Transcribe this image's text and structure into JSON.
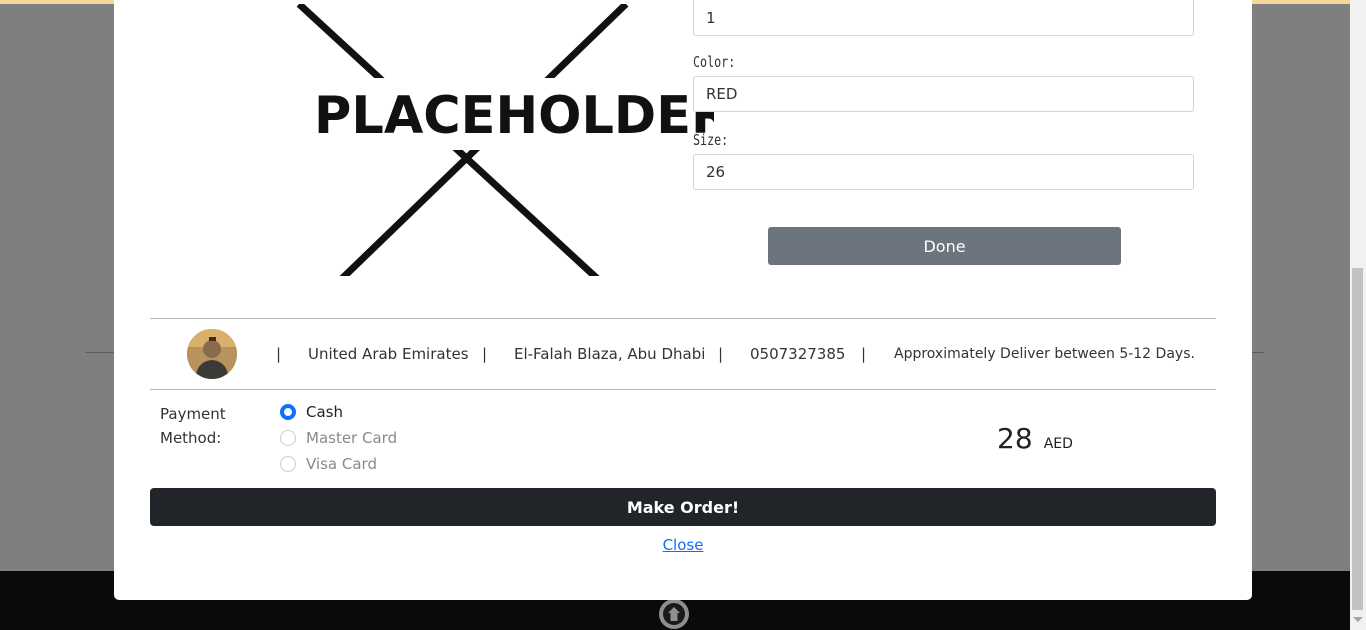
{
  "modal": {
    "product_image": {
      "text": "PLACEHOLDER"
    },
    "fields": [
      {
        "label": "",
        "value": "1"
      },
      {
        "label": "Color:",
        "value": "RED"
      },
      {
        "label": "Size:",
        "value": "26"
      }
    ],
    "done_label": "Done",
    "delivery": {
      "separator": "|",
      "country": "United Arab Emirates",
      "address": "El-Falah Blaza, Abu Dhabi",
      "phone": "0507327385",
      "estimate": "Approximately Deliver between 5-12 Days."
    },
    "payment": {
      "label": "Payment Method:",
      "options": [
        {
          "label": "Cash",
          "selected": true,
          "enabled": true
        },
        {
          "label": "Master Card",
          "selected": false,
          "enabled": false
        },
        {
          "label": "Visa Card",
          "selected": false,
          "enabled": false
        }
      ]
    },
    "price": {
      "amount": "28",
      "currency": "AED"
    },
    "make_order_label": "Make Order!",
    "close_label": "Close"
  },
  "icons": {
    "back_to_top": "arrow-up-circle-icon",
    "avatar": "user-avatar"
  },
  "colors": {
    "primary": "#0d6efd",
    "dark_button": "#212529",
    "secondary_button": "#6c757d",
    "overlay": "#7f7f7f"
  }
}
